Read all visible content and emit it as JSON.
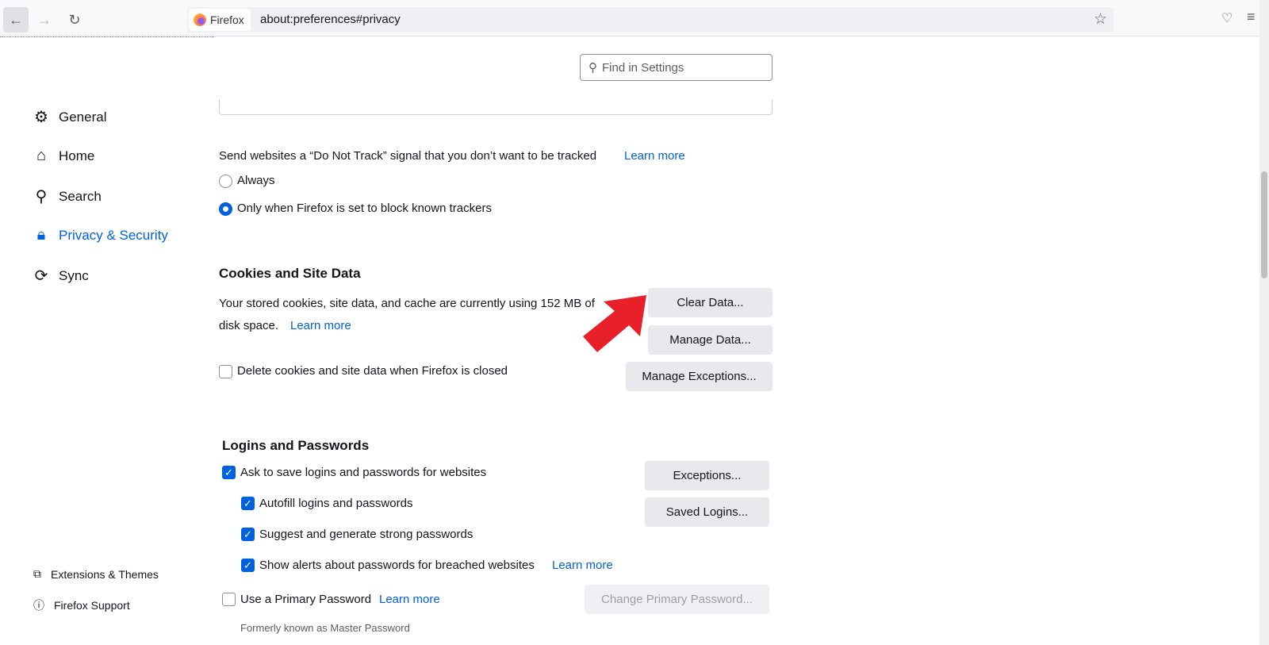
{
  "browser": {
    "identity": "Firefox",
    "url": "about:preferences#privacy"
  },
  "sidebar": {
    "items": [
      {
        "label": "General",
        "icon": "gear-icon"
      },
      {
        "label": "Home",
        "icon": "home-icon"
      },
      {
        "label": "Search",
        "icon": "search-icon"
      },
      {
        "label": "Privacy & Security",
        "icon": "lock-icon"
      },
      {
        "label": "Sync",
        "icon": "sync-icon"
      }
    ],
    "footer": [
      {
        "label": "Extensions & Themes",
        "icon": "puzzle-icon"
      },
      {
        "label": "Firefox Support",
        "icon": "help-icon"
      }
    ]
  },
  "search": {
    "placeholder": "Find in Settings"
  },
  "dnt": {
    "text": "Send websites a “Do Not Track” signal that you don’t want to be tracked",
    "learn_more": "Learn more",
    "options": [
      "Always",
      "Only when Firefox is set to block known trackers"
    ],
    "selected": 1
  },
  "cookies": {
    "heading": "Cookies and Site Data",
    "desc1": "Your stored cookies, site data, and cache are currently using 152 MB of",
    "desc2": "disk space.",
    "learn_more": "Learn more",
    "delete_label": "Delete cookies and site data when Firefox is closed",
    "buttons": [
      "Clear Data...",
      "Manage Data...",
      "Manage Exceptions..."
    ]
  },
  "logins": {
    "heading": "Logins and Passwords",
    "ask": "Ask to save logins and passwords for websites",
    "autofill": "Autofill logins and passwords",
    "suggest": "Suggest and generate strong passwords",
    "alerts": "Show alerts about passwords for breached websites",
    "alerts_learn": "Learn more",
    "primary": "Use a Primary Password",
    "primary_learn": "Learn more",
    "formerly": "Formerly known as Master Password",
    "buttons": [
      "Exceptions...",
      "Saved Logins...",
      "Change Primary Password..."
    ]
  },
  "colors": {
    "accent": "#0061e0",
    "arrow": "#e8202a"
  }
}
